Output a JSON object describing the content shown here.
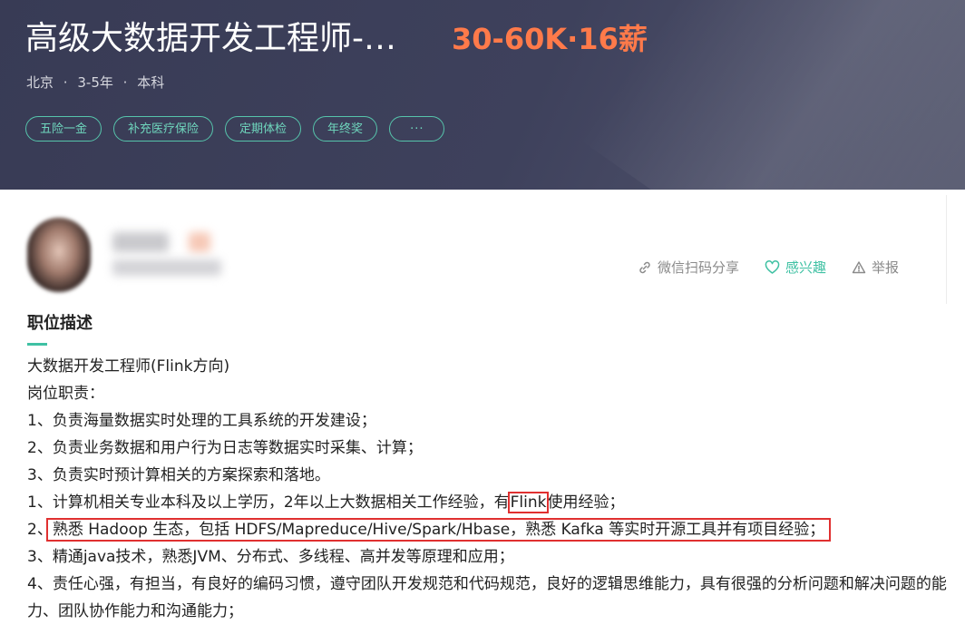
{
  "job": {
    "title": "高级大数据开发工程师-…",
    "salary": "30-60K·16薪",
    "location": "北京",
    "experience": "3-5年",
    "education": "本科",
    "separator": "·",
    "tags": [
      "五险一金",
      "补充医疗保险",
      "定期体检",
      "年终奖",
      "···"
    ]
  },
  "actions": {
    "share": "微信扫码分享",
    "interest": "感兴趣",
    "report": "举报"
  },
  "description": {
    "heading": "职位描述",
    "lines": [
      "大数据开发工程师(Flink方向)",
      "岗位职责：",
      "1、负责海量数据实时处理的工具系统的开发建设；",
      "2、负责业务数据和用户行为日志等数据实时采集、计算；",
      "3、负责实时预计算相关的方案探索和落地。"
    ],
    "req1_prefix": "1、计算机相关专业本科及以上学历，2年以上大数据相关工作经验，有",
    "req1_highlight": "Flink",
    "req1_suffix": "使用经验；",
    "req2_prefix": "2、",
    "req2_highlight": "熟悉 Hadoop 生态，包括 HDFS/Mapreduce/Hive/Spark/Hbase，熟悉 Kafka 等实时开源工具并有项目经验；",
    "req3": "3、精通java技术，熟悉JVM、分布式、多线程、高并发等原理和应用；",
    "req4": "4、责任心强，有担当，有良好的编码习惯，遵守团队开发规范和代码规范，良好的逻辑思维能力，具有很强的分析问题和解决问题的能力、团队协作能力和沟通能力；"
  },
  "colors": {
    "accent": "#3fc1a3",
    "salary": "#ff7a4a",
    "highlight_box": "#e03030",
    "header_bg": "#3e415c"
  }
}
